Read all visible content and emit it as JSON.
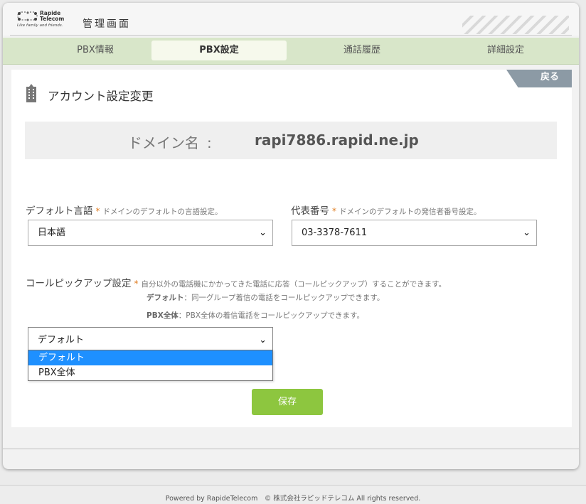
{
  "header": {
    "logo_name_line1": "Rapide",
    "logo_name_line2": "Telecom",
    "logo_tagline": "Like family and friends.",
    "app_title": "管理画面"
  },
  "tabs": [
    {
      "label": "PBX情報",
      "active": false
    },
    {
      "label": "PBX設定",
      "active": true
    },
    {
      "label": "通話履歴",
      "active": false
    },
    {
      "label": "詳細設定",
      "active": false
    }
  ],
  "page": {
    "back_label": "戻る",
    "title": "アカウント設定変更"
  },
  "domain": {
    "label": "ドメイン名",
    "colon": ":",
    "value": "rapi7886.rapid.ne.jp"
  },
  "fields": {
    "language": {
      "label": "デフォルト言語",
      "required_mark": "*",
      "hint": "ドメインのデフォルトの言語設定。",
      "value": "日本語"
    },
    "main_number": {
      "label": "代表番号",
      "required_mark": "*",
      "hint": "ドメインのデフォルトの発信者番号設定。",
      "value": "03-3378-7611"
    },
    "pickup": {
      "label": "コールピックアップ設定",
      "required_mark": "*",
      "hint": "自分以外の電話機にかかってきた電話に応答（コールピックアップ）することができます。",
      "desc1_term": "デフォルト",
      "desc1_text": "：同一グループ着信の電話をコールピックアップできます。",
      "desc2_term": "PBX全体",
      "desc2_text": "：PBX全体の着信電話をコールピックアップできます。",
      "value": "デフォルト",
      "options": [
        "デフォルト",
        "PBX全体"
      ],
      "highlighted_option": "デフォルト"
    }
  },
  "save_label": "保存",
  "footer": {
    "copyright": "Powered by RapideTelecom　© 株式会社ラピッドテレコム All rights reserved."
  },
  "colors": {
    "tab_bar": "#d8e6c9",
    "save_button": "#8dc63f",
    "back_button": "#8c9aa5",
    "required": "#e07b1f",
    "option_highlight": "#1e90ff"
  },
  "icons": {
    "logo": "rapide-logo-icon",
    "heading": "building-icon",
    "select_arrow": "chevron-down-icon"
  }
}
